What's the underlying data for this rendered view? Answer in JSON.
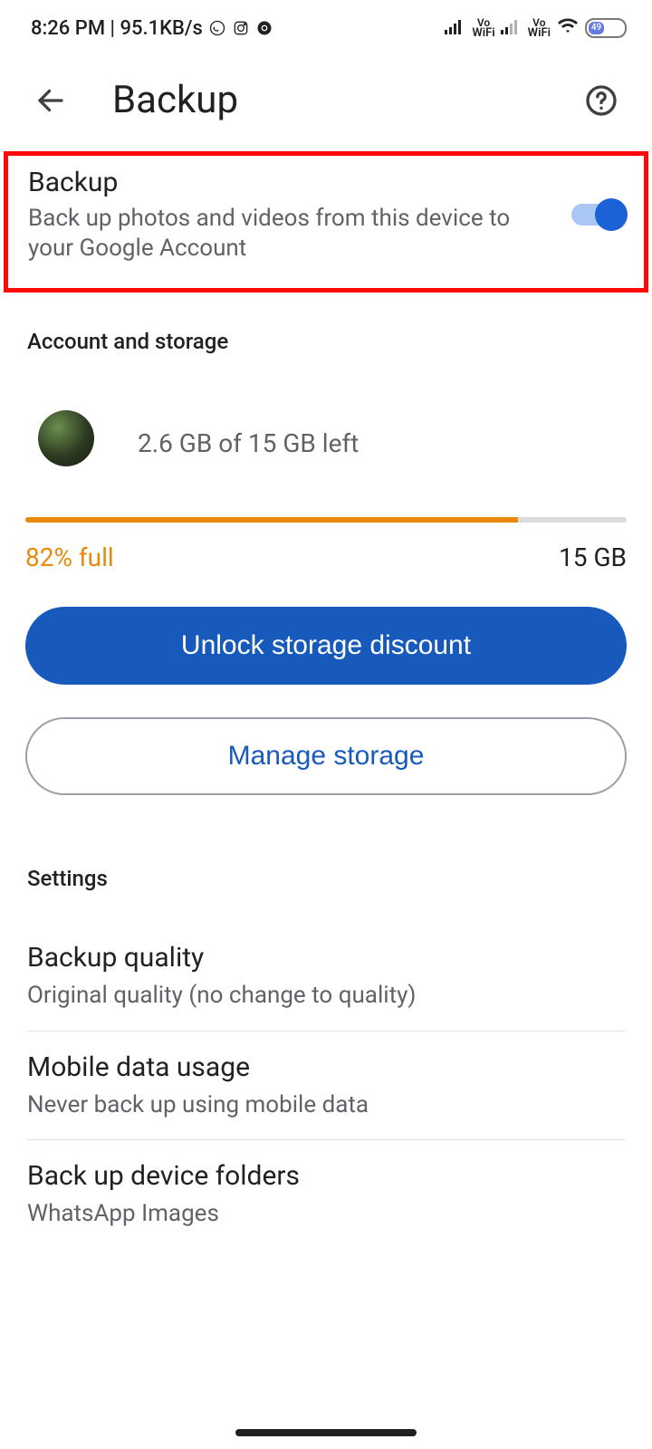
{
  "statusbar": {
    "time_text": "8:26 PM | 95.1KB/s",
    "battery_text": "49"
  },
  "appbar": {
    "title": "Backup"
  },
  "backup_toggle": {
    "title": "Backup",
    "description": "Back up photos and videos from this device to your Google Account",
    "enabled": true
  },
  "sections": {
    "account_label": "Account and storage",
    "settings_label": "Settings"
  },
  "storage": {
    "summary": "2.6 GB of 15 GB left",
    "percent_label": "82% full",
    "percent_value": 82,
    "capacity_label": "15 GB"
  },
  "buttons": {
    "unlock": "Unlock storage discount",
    "manage": "Manage storage"
  },
  "settings": {
    "quality": {
      "title": "Backup quality",
      "sub": "Original quality (no change to quality)"
    },
    "mobile": {
      "title": "Mobile data usage",
      "sub": "Never back up using mobile data"
    },
    "folders": {
      "title": "Back up device folders",
      "sub": "WhatsApp Images"
    }
  }
}
